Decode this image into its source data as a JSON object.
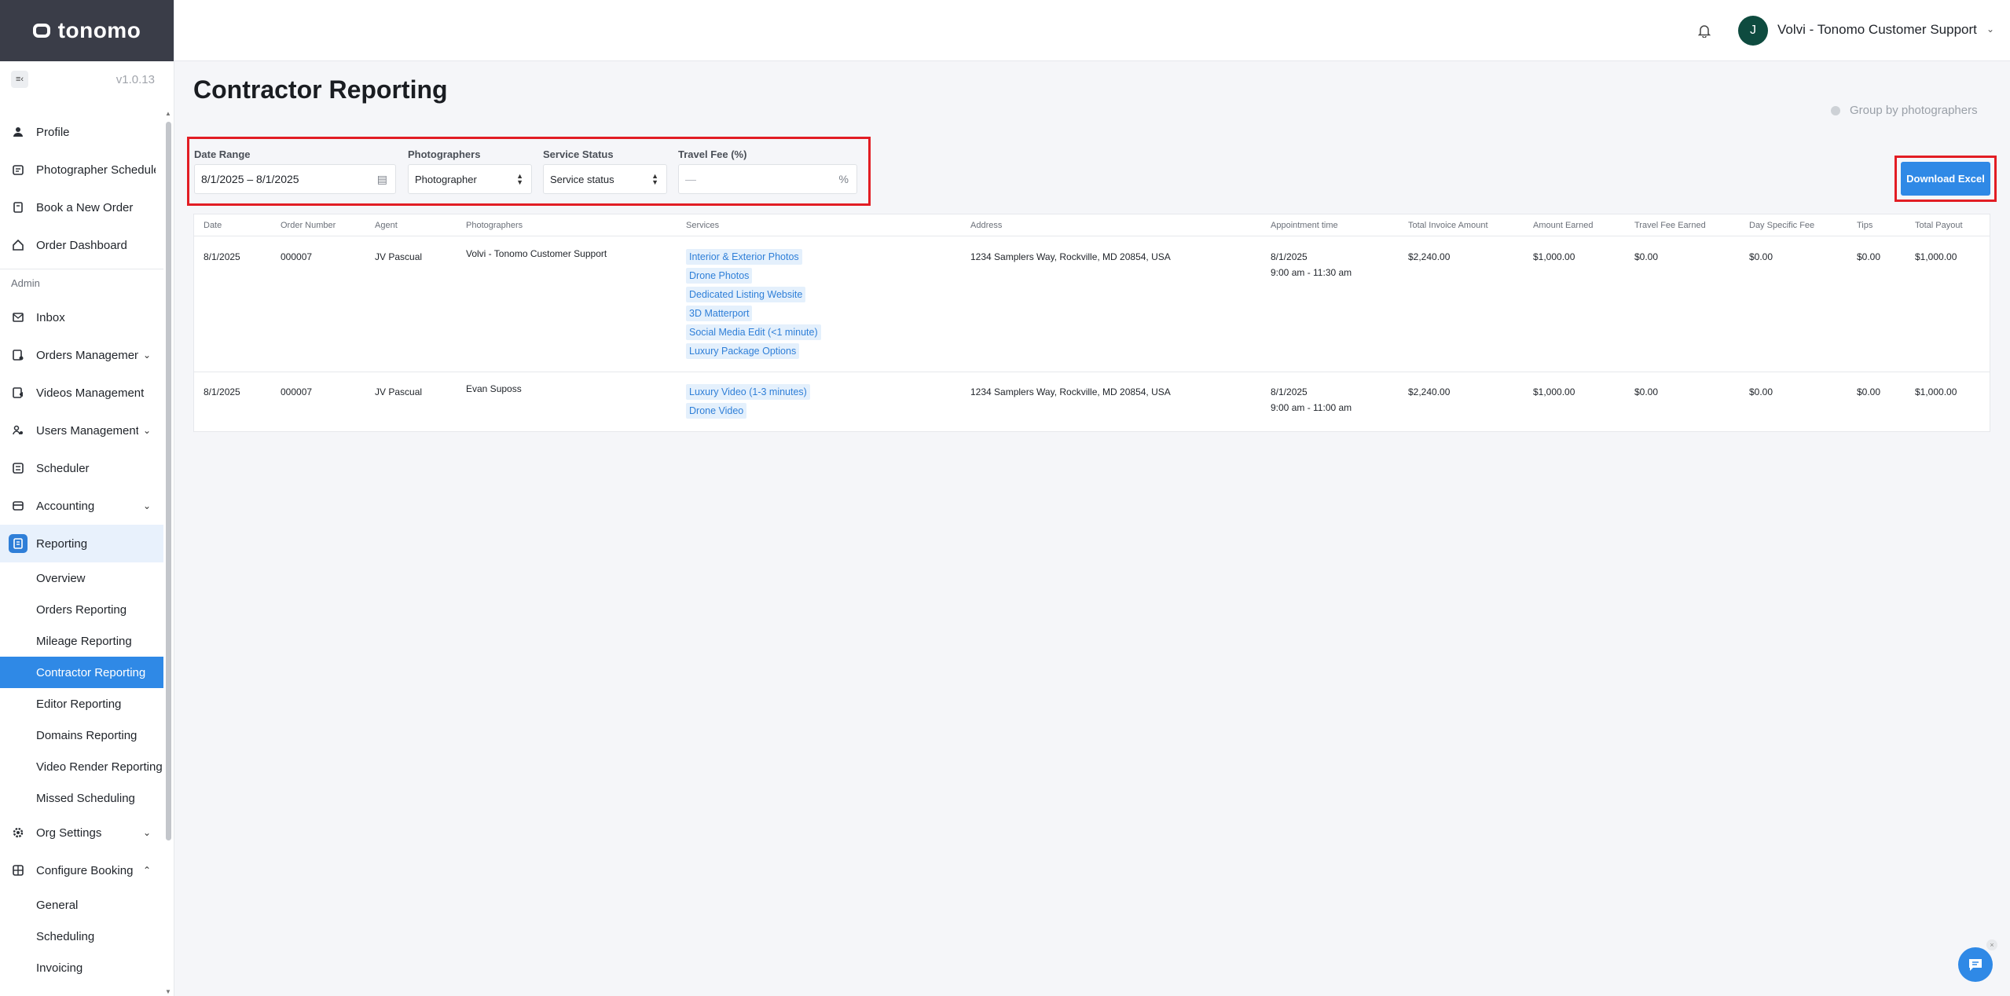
{
  "brand": {
    "name": "tonomo",
    "logo_icon": "tonomo-logo-icon",
    "version": "v1.0.13"
  },
  "sidebar": {
    "collapse_icon": "sidebar-collapse-icon",
    "main_items": [
      {
        "label": "Profile",
        "icon": "user-icon"
      },
      {
        "label": "Photographer Schedule",
        "icon": "calendar-icon"
      },
      {
        "label": "Book a New Order",
        "icon": "book-icon"
      },
      {
        "label": "Order Dashboard",
        "icon": "home-icon"
      }
    ],
    "admin_label": "Admin",
    "admin_items": [
      {
        "label": "Inbox",
        "icon": "mail-icon"
      },
      {
        "label": "Orders Management",
        "icon": "orders-icon"
      },
      {
        "label": "Videos Management",
        "icon": "video-icon"
      },
      {
        "label": "Users Management",
        "icon": "users-icon"
      },
      {
        "label": "Scheduler",
        "icon": "scheduler-icon"
      },
      {
        "label": "Accounting",
        "icon": "accounting-icon"
      },
      {
        "label": "Reporting",
        "icon": "reporting-icon"
      }
    ],
    "reporting_sub": [
      "Overview",
      "Orders Reporting",
      "Mileage Reporting",
      "Contractor Reporting",
      "Editor Reporting",
      "Domains Reporting",
      "Video Render Reporting",
      "Missed Scheduling"
    ],
    "bottom_items": [
      {
        "label": "Org Settings",
        "icon": "gear-icon"
      },
      {
        "label": "Configure Booking",
        "icon": "grid-icon"
      }
    ],
    "configure_sub": [
      "General",
      "Scheduling",
      "Invoicing"
    ]
  },
  "header": {
    "bell_icon": "bell-icon",
    "avatar_letter": "J",
    "user_name": "Volvi - Tonomo Customer Support"
  },
  "page": {
    "title": "Contractor Reporting",
    "group_toggle_label": "Group by photographers"
  },
  "filters": {
    "date_range_label": "Date Range",
    "date_range_value": "8/1/2025 – 8/1/2025",
    "photographers_label": "Photographers",
    "photographers_value": "Photographer",
    "service_status_label": "Service Status",
    "service_status_value": "Service status",
    "travel_fee_label": "Travel Fee (%)",
    "travel_fee_placeholder": "—",
    "travel_fee_suffix": "%"
  },
  "download_button": "Download Excel",
  "table": {
    "columns": [
      "Date",
      "Order Number",
      "Agent",
      "Photographers",
      "Services",
      "Address",
      "Appointment time",
      "Total Invoice Amount",
      "Amount Earned",
      "Travel Fee Earned",
      "Day Specific Fee",
      "Tips",
      "Total Payout"
    ],
    "rows": [
      {
        "date": "8/1/2025",
        "order_number": "000007",
        "agent": "JV Pascual",
        "photographer": "Volvi - Tonomo Customer Support",
        "services": [
          "Interior & Exterior Photos",
          "Drone Photos",
          "Dedicated Listing Website",
          "3D Matterport",
          "Social Media Edit (<1 minute)",
          "Luxury Package Options"
        ],
        "address": "1234 Samplers Way, Rockville, MD 20854, USA",
        "appt_date": "8/1/2025",
        "appt_time": "9:00 am - 11:30 am",
        "total_invoice": "$2,240.00",
        "amount_earned": "$1,000.00",
        "travel_fee": "$0.00",
        "day_fee": "$0.00",
        "tips": "$0.00",
        "total_payout": "$1,000.00"
      },
      {
        "date": "8/1/2025",
        "order_number": "000007",
        "agent": "JV Pascual",
        "photographer": "Evan Suposs",
        "services": [
          "Luxury Video (1-3 minutes)",
          "Drone Video"
        ],
        "address": "1234 Samplers Way, Rockville, MD 20854, USA",
        "appt_date": "8/1/2025",
        "appt_time": "9:00 am - 11:00 am",
        "total_invoice": "$2,240.00",
        "amount_earned": "$1,000.00",
        "travel_fee": "$0.00",
        "day_fee": "$0.00",
        "tips": "$0.00",
        "total_payout": "$1,000.00"
      }
    ]
  },
  "chat_icon": "chat-support-icon"
}
